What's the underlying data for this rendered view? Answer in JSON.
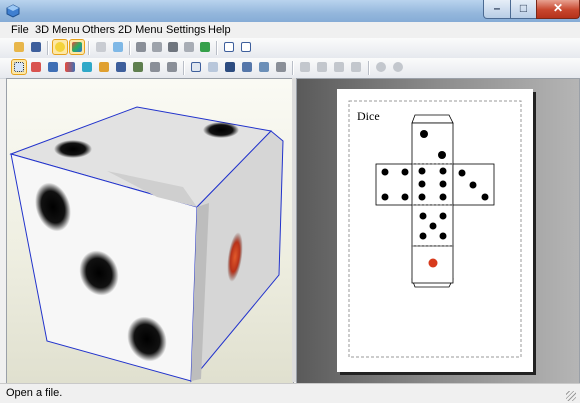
{
  "menu": [
    "File",
    "3D Menu",
    "Others",
    "2D Menu",
    "Settings",
    "Help"
  ],
  "net": {
    "title": "Dice"
  },
  "status": {
    "text": "Open a file."
  },
  "colors": {
    "face_outline": "#2233cc",
    "one_pip": "#d73a1c",
    "title_bar": "#94b7dc"
  },
  "icons": {
    "toolbar_1": [
      "open-folder-icon",
      "save-icon",
      "light-bulb-icon",
      "color-cube-icon",
      "unfold-icon",
      "texture-icon",
      "pencil-icon",
      "cylinder-icon",
      "anchor-icon",
      "flap-icon",
      "export-icon",
      "single-view-icon",
      "split-view-icon"
    ],
    "toolbar_2": [
      "select-icon",
      "edge-icon",
      "join-icon",
      "move-parts-icon",
      "rotate-part-icon",
      "flip-part-icon",
      "page-icon",
      "cut-icon",
      "undo-icon",
      "redo-icon",
      "fit-icon",
      "zoom-pages-icon",
      "pdf-icon",
      "layout-icon",
      "settings-page-icon",
      "print-icon",
      "align-left-icon",
      "align-right-icon",
      "align-top-icon",
      "align-bottom-icon",
      "rotate-90-ccw-icon",
      "rotate-90-cw-icon"
    ]
  }
}
